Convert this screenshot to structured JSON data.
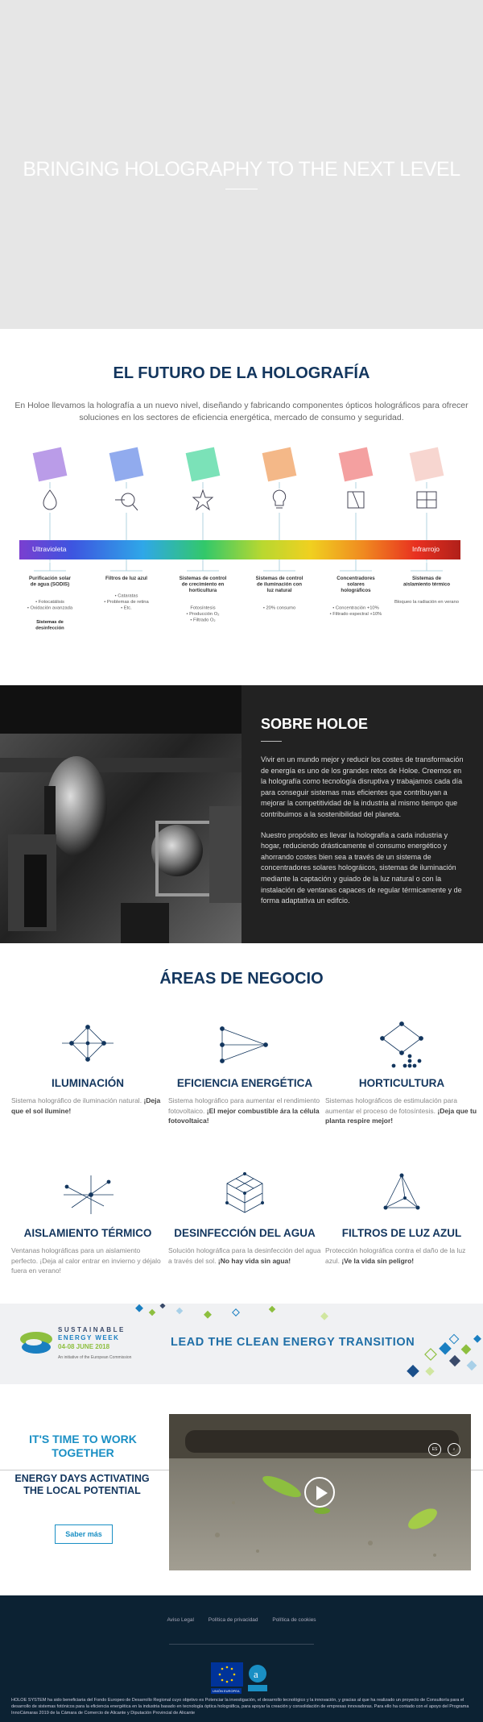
{
  "hero": {
    "title": "BRINGING HOLOGRAPHY TO THE NEXT LEVEL"
  },
  "future": {
    "title": "EL FUTURO DE LA HOLOGRAFÍA",
    "intro": "En Holoe llevamos la holografía a un nuevo nivel, diseñando y fabricando componentes ópticos holográficos para ofrecer soluciones en los sectores de eficiencia energética, mercado de consumo y seguridad.",
    "spectrum_left": "Ultravioleta",
    "spectrum_right": "Infrarrojo",
    "columns": [
      {
        "icon": "droplet-icon",
        "color": "#a37be0",
        "title": "Purificación solar de agua (SODIS)",
        "bullets": [
          "• Fotocatálisis",
          "• Oxidación avanzada"
        ],
        "extra": "Sistemas de desinfección"
      },
      {
        "icon": "eye-magnifier-icon",
        "color": "#6c8fe8",
        "title": "Filtros de luz azul",
        "bullets": [
          "• Cataratas",
          "• Problemas de retina",
          "• Etc."
        ],
        "extra": ""
      },
      {
        "icon": "plant-icon",
        "color": "#4fd8a0",
        "title": "Sistemas de control de crecimiento en horticultura",
        "bullets": [
          "Fotosíntesis",
          "• Producción O₂",
          "• Filtrado O₂"
        ],
        "extra": ""
      },
      {
        "icon": "lightbulb-icon",
        "color": "#f0a060",
        "title": "Sistemas de control de iluminación con luz natural",
        "bullets": [
          "• 20% consumo"
        ],
        "extra": ""
      },
      {
        "icon": "solar-cell-icon",
        "color": "#f08080",
        "title": "Concentradores solares holográficos",
        "bullets": [
          "• Concentración +10%",
          "• Filtrado espectral +10%"
        ],
        "extra": ""
      },
      {
        "icon": "window-icon",
        "color": "#f4c8c0",
        "title": "Sistemas de aislamiento térmico",
        "bullets": [
          "Bloqueo la radiación en verano"
        ],
        "extra": ""
      }
    ]
  },
  "about": {
    "title": "SOBRE HOLOE",
    "p1": "Vivir en un mundo mejor y reducir los costes de transformación de energía es uno de los grandes retos de Holoe. Creemos en la holografía como tecnología disruptiva y trabajamos cada día para conseguir sistemas mas eficientes que contribuyan a mejorar la competitividad de la industria al mismo tiempo que contribuimos a la sostenibilidad del planeta.",
    "p2": "Nuestro propósito es llevar la holografía a cada industria y hogar, reduciendo drásticamente el consumo energético y ahorrando costes bien sea a través de un sistema de concentradores solares holográicos, sistemas de iluminación mediante la captación y guiado de la luz natural o con la instalación de ventanas capaces de regular térmicamente y de forma adaptativa un edifcio."
  },
  "areas": {
    "title": "ÁREAS DE NEGOCIO",
    "items": [
      {
        "icon": "network-diamond-icon",
        "title": "ILUMINACIÓN",
        "text": "Sistema holográfico de iluminación natural.",
        "bold": "¡Deja que el sol ilumine!"
      },
      {
        "icon": "converging-rays-icon",
        "title": "EFICIENCIA ENERGÉTICA",
        "text": "Sistema holográfico para aumentar el rendimiento fotovoltaico.",
        "bold": "¡El mejor combustible ára la célula fotovoltaica!"
      },
      {
        "icon": "dot-grid-diamond-icon",
        "title": "HORTICULTURA",
        "text": "Sistemas holográficos de estimulación para aumentar el proceso de fotosíntesis.",
        "bold": "¡Deja que tu planta respire mejor!"
      },
      {
        "icon": "crossed-lines-icon",
        "title": "AISLAMIENTO TÉRMICO",
        "text": "Ventanas holográficas para un aislamiento perfecto. ¡Deja al calor entrar en invierno y déjalo fuera en verano!",
        "bold": ""
      },
      {
        "icon": "cube-icon",
        "title": "DESINFECCIÓN DEL AGUA",
        "text": "Solución holográfica para la desinfección del agua a través del sol.",
        "bold": "¡No hay vida sin agua!"
      },
      {
        "icon": "pyramid-icon",
        "title": "FILTROS DE LUZ AZUL",
        "text": "Protección holográfica contra el daño de la luz azul.",
        "bold": "¡Ve la vida sin peligro!"
      }
    ]
  },
  "banner": {
    "line1": "SUSTAINABLE",
    "line2": "ENERGY WEEK",
    "dates": "04-08 JUNE 2018",
    "small": "An initiative of the European Commission",
    "slogan": "LEAD THE CLEAN ENERGY TRANSITION"
  },
  "energy": {
    "title": "IT'S TIME TO WORK TOGETHER",
    "subtitle": "ENERGY DAYS ACTIVATING THE LOCAL POTENTIAL",
    "button": "Saber más",
    "lang": "ES"
  },
  "footer": {
    "links": [
      "Aviso Legal",
      "Política de privacidad",
      "Política de cookies"
    ],
    "eu_label": "UNIÓN EUROPEA",
    "legal": "HOLOE SYSTEM ha sido beneficiaria del Fondo Europeo de Desarrollo Regional cuyo objetivo es Potenciar la investigación, el desarrollo tecnológico y la innovación, y gracias al que ha realizado un proyecto de Consultoría para el desarrollo de sistemas fotónicos para la eficiencia energética en la industria basado en tecnología óptica holográfica, para apoyar la creación y consolidación de empresas innovadoras. Para ello ha contado con el apoyo del Programa InnoCámaras 2019 de la Cámara de Comercio de Alicante y Diputación Provincial de Alicante"
  }
}
